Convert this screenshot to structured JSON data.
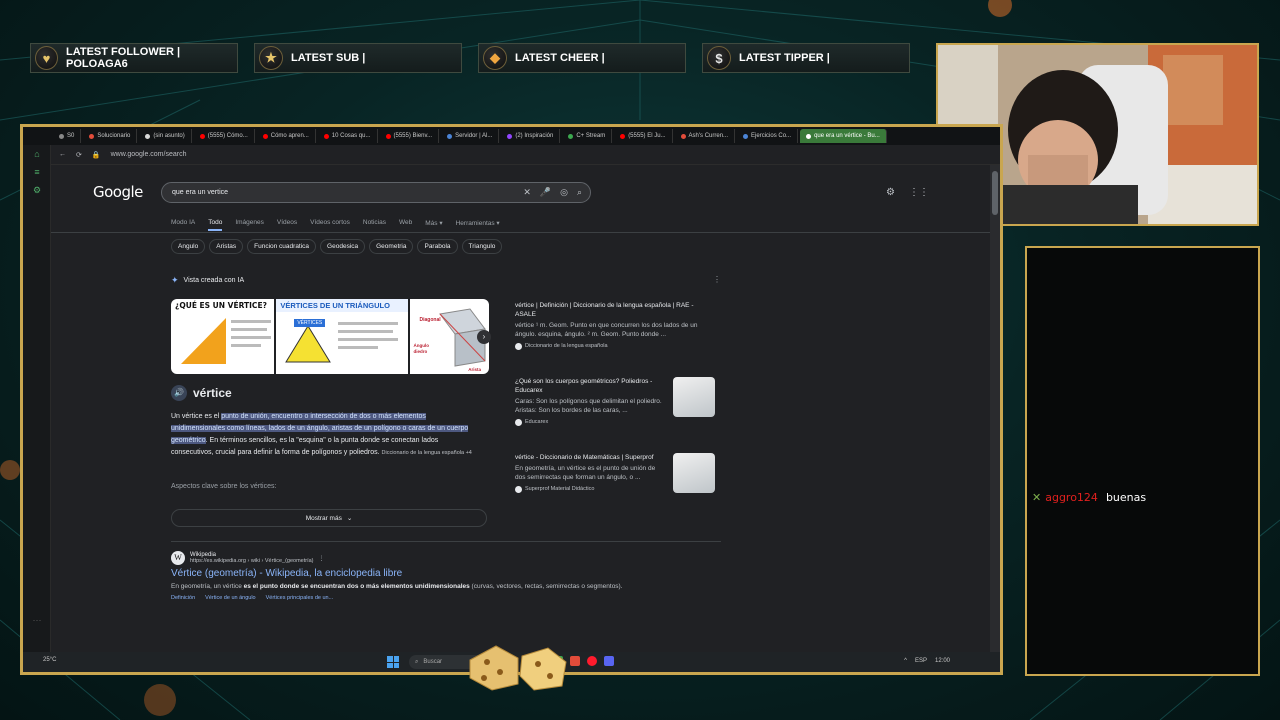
{
  "overlay": {
    "alerts": [
      {
        "label": "LATEST FOLLOWER | POLOAGA6",
        "icon": "heart-icon",
        "glyph": "♥",
        "color": "#e6c46a"
      },
      {
        "label": "LATEST SUB |",
        "icon": "star-icon",
        "glyph": "★",
        "color": "#e6c46a"
      },
      {
        "label": "LATEST CHEER |",
        "icon": "diamond-icon",
        "glyph": "◆",
        "color": "#f0a640"
      },
      {
        "label": "LATEST TIPPER |",
        "icon": "dollar-icon",
        "glyph": "$",
        "color": "#e6e6e6"
      }
    ],
    "frame_color": "#c9a64f",
    "chat": {
      "username": "aggro124",
      "message": "buenas",
      "username_color": "#e0201e"
    }
  },
  "browser": {
    "tabs": [
      {
        "label": "S0",
        "color": "#888888"
      },
      {
        "label": "Solucionario",
        "color": "#e24c3a"
      },
      {
        "label": "(sin asunto)",
        "color": "#d8d8d8"
      },
      {
        "label": "(5555) Cómo...",
        "color": "#ff0000"
      },
      {
        "label": "Cómo apren...",
        "color": "#ff0000"
      },
      {
        "label": "10 Cosas qu...",
        "color": "#ff0000"
      },
      {
        "label": "(5555) Bienv...",
        "color": "#ff0000"
      },
      {
        "label": "Servidor | Al...",
        "color": "#4b84d6"
      },
      {
        "label": "(2) Inspiración",
        "color": "#9146ff"
      },
      {
        "label": "C+ Stream",
        "color": "#3ca84f"
      },
      {
        "label": "(5555) El Ju...",
        "color": "#ff0000"
      },
      {
        "label": "Ash's Curren...",
        "color": "#e24c3a"
      },
      {
        "label": "Ejercicios Co...",
        "color": "#4b84d6"
      },
      {
        "label": "que era un vértice - Bu...",
        "color": "#ffffff",
        "active": true
      }
    ],
    "url": "www.google.com/search"
  },
  "google": {
    "logo": "Google",
    "query": "que era un vertice",
    "tabs": [
      "Modo IA",
      "Todo",
      "Imágenes",
      "Vídeos",
      "Vídeos cortos",
      "Noticias",
      "Web",
      "Más ▾",
      "Herramientas ▾"
    ],
    "chips": [
      "Angulo",
      "Aristas",
      "Funcion cuadratica",
      "Geodesica",
      "Geometria",
      "Parabola",
      "Triangulo"
    ],
    "ai_header": "Vista creada con IA",
    "images": [
      {
        "title": "¿QUÉ ES UN VÉRTICE?"
      },
      {
        "title": "VÉRTICES DE UN TRIÁNGULO",
        "tag": "VÉRTICES"
      },
      {
        "title": "Diagonal",
        "sub": "Ángulo diedro",
        "sub2": "Arista"
      }
    ],
    "word": "vértice",
    "ai_text": {
      "pre": "Un vértice es el ",
      "highlight": "punto de unión, encuentro o intersección de dos o más elementos unidimensionales como líneas, lados de un ángulo, aristas de un polígono o caras de un cuerpo geométrico",
      "post": ". En términos sencillos, es la \"esquina\" o la punta donde se conectan lados consecutivos, crucial para definir la forma de polígonos y poliedros. ",
      "source": "Diccionario de la lengua española +4"
    },
    "aspects": "Aspectos clave sobre los vértices:",
    "show_more": "Mostrar más",
    "side_results": [
      {
        "title": "vértice | Definición | Diccionario de la lengua española | RAE - ASALE",
        "text": "vértice ¹ m. Geom. Punto en que concurren los dos lados de un ángulo. esquina, ángulo. ² m. Geom. Punto donde ...",
        "source": "Diccionario de la lengua española",
        "has_thumb": false
      },
      {
        "title": "¿Qué son los cuerpos geométricos? Poliedros - Educarex",
        "text": "Caras: Son los polígonos que delimitan el poliedro. Aristas: Son los bordes de las caras, ...",
        "source": "Educarex",
        "has_thumb": true
      },
      {
        "title": "vértice - Diccionario de Matemáticas | Superprof",
        "text": "En geometría, un vértice es el punto de unión de dos semirrectas que forman un ángulo, o ...",
        "source": "Superprof Material Didáctico",
        "has_thumb": true
      }
    ],
    "wiki": {
      "site": "Wikipedia",
      "url": "https://es.wikipedia.org › wiki › Vértice_(geometría)",
      "title": "Vértice (geometría) - Wikipedia, la enciclopedia libre",
      "snippet_pre": "En geometría, un vértice ",
      "snippet_bold": "es el punto donde se encuentran dos o más elementos unidimensionales",
      "snippet_post": " (curvas, vectores, rectas, semirrectas o segmentos).",
      "links": [
        "Definición",
        "Vértice de un ángulo",
        "Vértices principales de un..."
      ]
    }
  },
  "taskbar": {
    "weather": "25°C",
    "search": "Buscar",
    "tray": [
      "^",
      "ESP",
      "12:00"
    ]
  }
}
